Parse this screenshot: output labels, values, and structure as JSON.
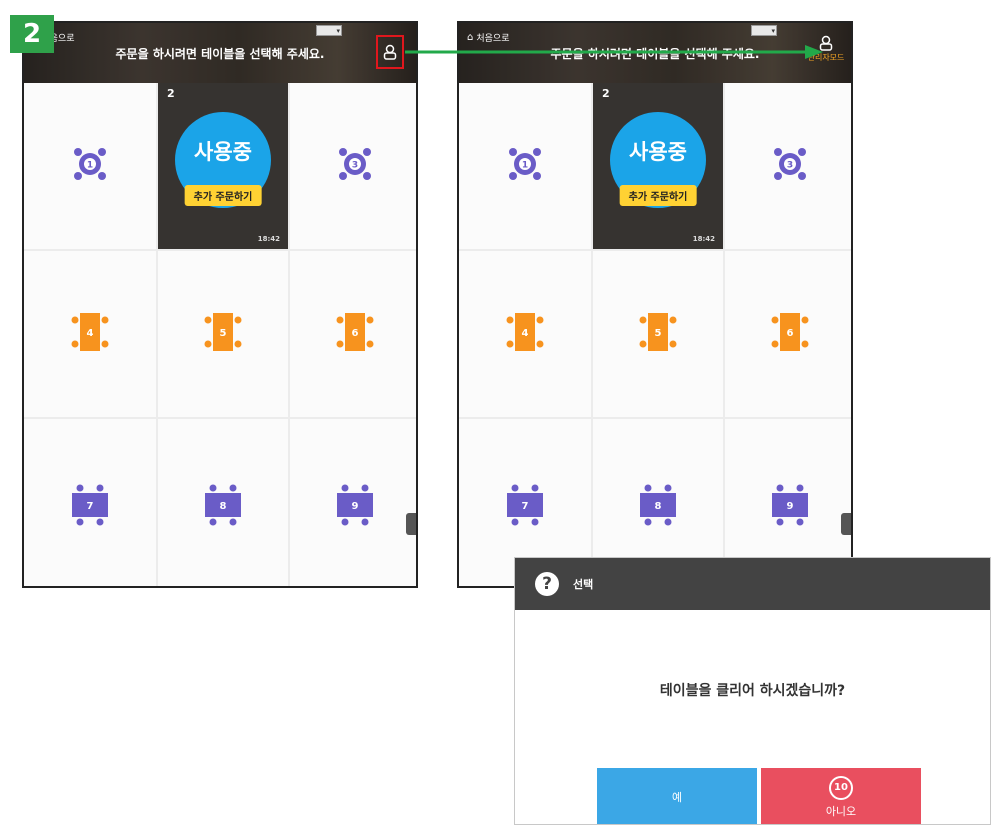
{
  "step_badge": "2",
  "screens": [
    {
      "id": "screen-a",
      "home_label": "처음으로",
      "header_message": "주문을 하시려면 테이블을 선택해 주세요.",
      "admin_label": "",
      "tables": [
        {
          "number": "1",
          "shape": "round",
          "color": "#6a5cc7"
        },
        {
          "number": "2",
          "in_use": true,
          "status": "사용중",
          "add_order": "추가 주문하기",
          "time": "18:42"
        },
        {
          "number": "3",
          "shape": "round",
          "color": "#6a5cc7"
        },
        {
          "number": "4",
          "shape": "rect-v",
          "color": "#f7931e"
        },
        {
          "number": "5",
          "shape": "rect-v",
          "color": "#f7931e"
        },
        {
          "number": "6",
          "shape": "rect-v",
          "color": "#f7931e"
        },
        {
          "number": "7",
          "shape": "rect-h",
          "color": "#6a5cc7"
        },
        {
          "number": "8",
          "shape": "rect-h",
          "color": "#6a5cc7"
        },
        {
          "number": "9",
          "shape": "rect-h",
          "color": "#6a5cc7"
        }
      ]
    },
    {
      "id": "screen-b",
      "home_label": "처음으로",
      "header_message": "주문을 하시려면 테이블을 선택해 주세요.",
      "admin_label": "관리자모드",
      "tables": [
        {
          "number": "1",
          "shape": "round",
          "color": "#6a5cc7"
        },
        {
          "number": "2",
          "in_use": true,
          "status": "사용중",
          "add_order": "추가 주문하기",
          "time": "18:42"
        },
        {
          "number": "3",
          "shape": "round",
          "color": "#6a5cc7"
        },
        {
          "number": "4",
          "shape": "rect-v",
          "color": "#f7931e"
        },
        {
          "number": "5",
          "shape": "rect-v",
          "color": "#f7931e"
        },
        {
          "number": "6",
          "shape": "rect-v",
          "color": "#f7931e"
        },
        {
          "number": "7",
          "shape": "rect-h",
          "color": "#6a5cc7"
        },
        {
          "number": "8",
          "shape": "rect-h",
          "color": "#6a5cc7"
        },
        {
          "number": "9",
          "shape": "rect-h",
          "color": "#6a5cc7"
        }
      ]
    }
  ],
  "dialog": {
    "title": "선택",
    "message": "테이블을 클리어 하시겠습니까?",
    "yes_label": "예",
    "no_label": "아니오",
    "countdown": "10"
  },
  "colors": {
    "step_badge": "#2fa14a",
    "arrow": "#22a94a",
    "highlight": "#e0171d",
    "yes_button": "#3ba7e6",
    "no_button": "#e94f5f"
  }
}
